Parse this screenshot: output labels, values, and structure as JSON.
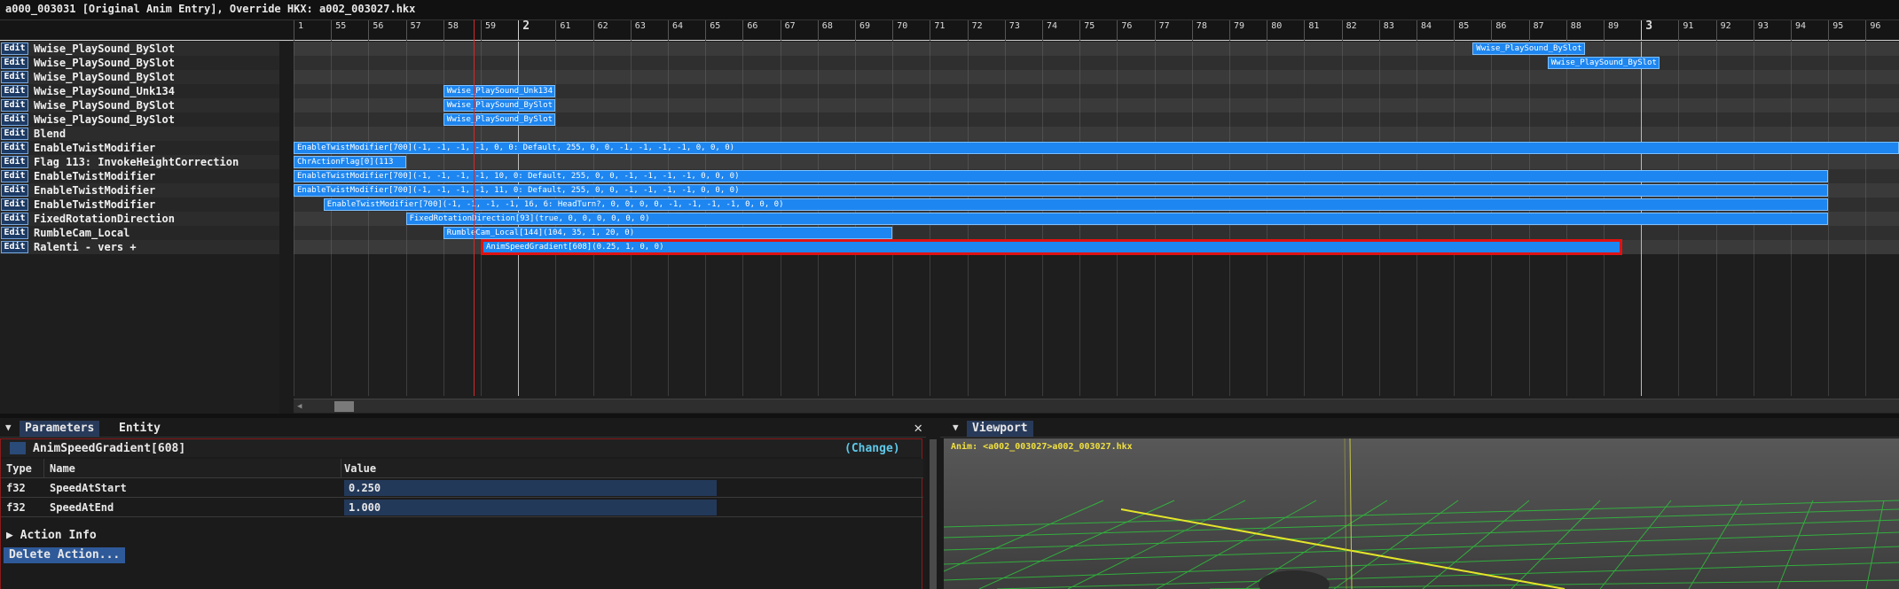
{
  "window": {
    "title": "a000_003031 [Original Anim Entry], Override HKX: a002_003027.hkx"
  },
  "ruler": {
    "labels": [
      "1",
      "55",
      "56",
      "57",
      "58",
      "59",
      "2",
      "61",
      "62",
      "63",
      "64",
      "65",
      "66",
      "67",
      "68",
      "69",
      "70",
      "71",
      "72",
      "73",
      "74",
      "75",
      "76",
      "77",
      "78",
      "79",
      "80",
      "81",
      "82",
      "83",
      "84",
      "85",
      "86",
      "87",
      "88",
      "89",
      "3",
      "91",
      "92",
      "93",
      "94",
      "95",
      "96"
    ]
  },
  "rows": [
    {
      "edit": "Edit",
      "label": "Wwise_PlaySound_BySlot"
    },
    {
      "edit": "Edit",
      "label": "Wwise_PlaySound_BySlot"
    },
    {
      "edit": "Edit",
      "label": "Wwise_PlaySound_BySlot"
    },
    {
      "edit": "Edit",
      "label": "Wwise_PlaySound_Unk134"
    },
    {
      "edit": "Edit",
      "label": "Wwise_PlaySound_BySlot"
    },
    {
      "edit": "Edit",
      "label": "Wwise_PlaySound_BySlot"
    },
    {
      "edit": "Edit",
      "label": "Blend"
    },
    {
      "edit": "Edit",
      "label": "EnableTwistModifier"
    },
    {
      "edit": "Edit",
      "label": "Flag 113: InvokeHeightCorrection"
    },
    {
      "edit": "Edit",
      "label": "EnableTwistModifier"
    },
    {
      "edit": "Edit",
      "label": "EnableTwistModifier"
    },
    {
      "edit": "Edit",
      "label": "EnableTwistModifier"
    },
    {
      "edit": "Edit",
      "label": "FixedRotationDirection"
    },
    {
      "edit": "Edit",
      "label": "RumbleCam_Local"
    },
    {
      "edit": "Edit",
      "label": "Ralenti - vers +"
    }
  ],
  "events": [
    {
      "row": 0,
      "label": "Wwise_PlaySound_BySlot",
      "start": 85.5,
      "end": 88.5
    },
    {
      "row": 1,
      "label": "Wwise_PlaySound_BySlot",
      "start": 87.5,
      "end": 90.5
    },
    {
      "row": 3,
      "label": "Wwise_PlaySound_Unk134",
      "start": 58,
      "end": 61
    },
    {
      "row": 4,
      "label": "Wwise_PlaySound_BySlot",
      "start": 58,
      "end": 61
    },
    {
      "row": 5,
      "label": "Wwise_PlaySound_BySlot",
      "start": 58,
      "end": 61
    },
    {
      "row": 7,
      "label": "EnableTwistModifier[700](-1, -1, -1, -1, 0, 0: Default, 255, 0, 0, -1, -1, -1, -1, 0, 0, 0)",
      "start": 54,
      "end": 99
    },
    {
      "row": 8,
      "label": "ChrActionFlag[0](113",
      "start": 54,
      "end": 57
    },
    {
      "row": 9,
      "label": "EnableTwistModifier[700](-1, -1, -1, -1, 10, 0: Default, 255, 0, 0, -1, -1, -1, -1, 0, 0, 0)",
      "start": 54,
      "end": 95
    },
    {
      "row": 10,
      "label": "EnableTwistModifier[700](-1, -1, -1, -1, 11, 0: Default, 255, 0, 0, -1, -1, -1, -1, 0, 0, 0)",
      "start": 54,
      "end": 95
    },
    {
      "row": 11,
      "label": "EnableTwistModifier[700](-1, -1, -1, -1, 16, 6: HeadTurn?, 0, 0, 0, 0, -1, -1, -1, -1, 0, 0, 0)",
      "start": 54.8,
      "end": 95
    },
    {
      "row": 12,
      "label": "FixedRotationDirection[93](true, 0, 0, 0, 0, 0, 0)",
      "start": 57,
      "end": 95
    },
    {
      "row": 13,
      "label": "RumbleCam_Local[144](104, 35, 1, 20, 0)",
      "start": 58,
      "end": 70
    },
    {
      "row": 14,
      "label": "AnimSpeedGradient[608](0.25, 1, 0, 0)",
      "start": 59,
      "end": 89.5,
      "selected": true
    }
  ],
  "scroll": {
    "left_arrow": "◀"
  },
  "params": {
    "collapse_icon": "▼",
    "tab_parameters": "Parameters",
    "tab_entity": "Entity",
    "close": "✕",
    "action_name": "AnimSpeedGradient[608]",
    "change": "(Change)",
    "col_type": "Type",
    "col_name": "Name",
    "col_value": "Value",
    "fields": [
      {
        "type": "f32",
        "name": "SpeedAtStart",
        "value": "0.250"
      },
      {
        "type": "f32",
        "name": "SpeedAtEnd",
        "value": "1.000"
      }
    ],
    "action_info": "▶  Action Info",
    "delete": "Delete Action..."
  },
  "viewport": {
    "collapse_icon": "▼",
    "tab": "Viewport",
    "anim_label": "Anim: <a002_003027>a002_003027.hkx"
  },
  "colors": {
    "event": "#1e86f0",
    "selection": "#e01212",
    "playhead": "#d42a2a",
    "change_link": "#5ec8e8",
    "anim_label": "#f0e040"
  }
}
